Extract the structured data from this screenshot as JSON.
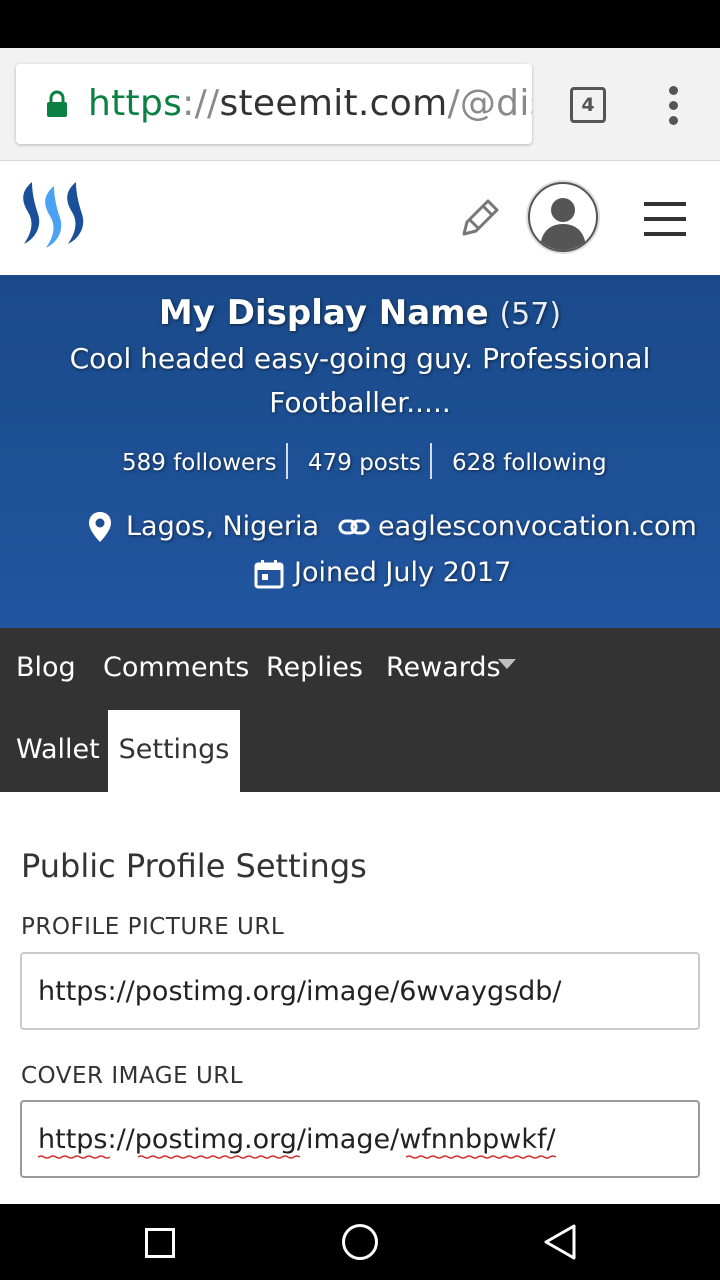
{
  "browser": {
    "url_scheme": "https",
    "url_separator": "://",
    "url_host": "steemit.com",
    "url_path": "/@disl",
    "tab_count": "4"
  },
  "profile": {
    "display_name": "My Display Name",
    "reputation": "(57)",
    "bio": "Cool headed easy-going guy. Professional Footballer.....",
    "followers": "589 followers",
    "posts": "479 posts",
    "following": "628 following",
    "location": "Lagos, Nigeria",
    "website": "eaglesconvocation.com",
    "joined": "Joined July 2017"
  },
  "nav": {
    "blog": "Blog",
    "comments": "Comments",
    "replies": "Replies",
    "rewards": "Rewards",
    "wallet": "Wallet",
    "settings": "Settings"
  },
  "settings": {
    "title": "Public Profile Settings",
    "profile_picture_label": "PROFILE PICTURE URL",
    "profile_picture_value": "https://postimg.org/image/6wvaygsdb/",
    "cover_image_label": "COVER IMAGE URL",
    "cover_image_value": "https://postimg.org/image/wfnnbpwkf/"
  },
  "colors": {
    "banner": "#1a4a8a",
    "nav_dark": "#333333",
    "secure_green": "#0b8043",
    "steem_blue": "#1a5099"
  }
}
